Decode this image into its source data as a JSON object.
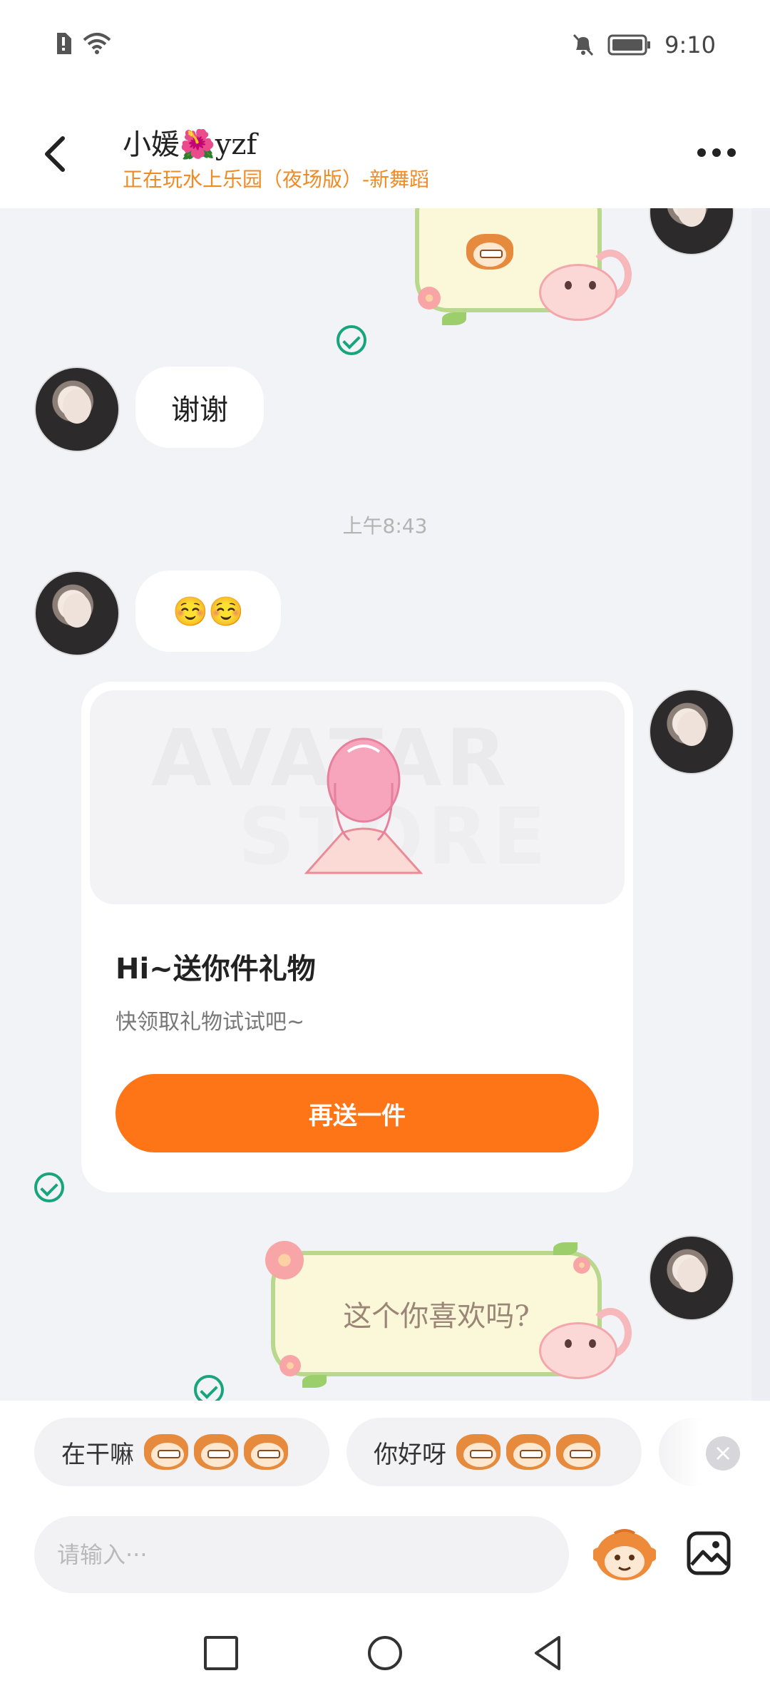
{
  "status_bar": {
    "time": "9:10"
  },
  "header": {
    "title": "小媛🌺yzf",
    "subtitle": "正在玩水上乐园（夜场版）-新舞蹈"
  },
  "messages": {
    "thanks": "谢谢",
    "timestamp": "上午8:43",
    "emoji_reply": "☺️☺️",
    "sticker_question": "这个你喜欢吗?"
  },
  "gift_card": {
    "watermark_line1": "AVATAR",
    "watermark_line2": "STORE",
    "title": "Hi~送你件礼物",
    "description": "快领取礼物试试吧~",
    "button_label": "再送一件"
  },
  "quick_replies": [
    {
      "label": "在干嘛"
    },
    {
      "label": "你好呀"
    }
  ],
  "input": {
    "placeholder": "请输入···"
  },
  "colors": {
    "accent": "#fe7518",
    "subtitle": "#f08a24",
    "read_check": "#18a57e",
    "sticker_border": "#b9d88d"
  }
}
